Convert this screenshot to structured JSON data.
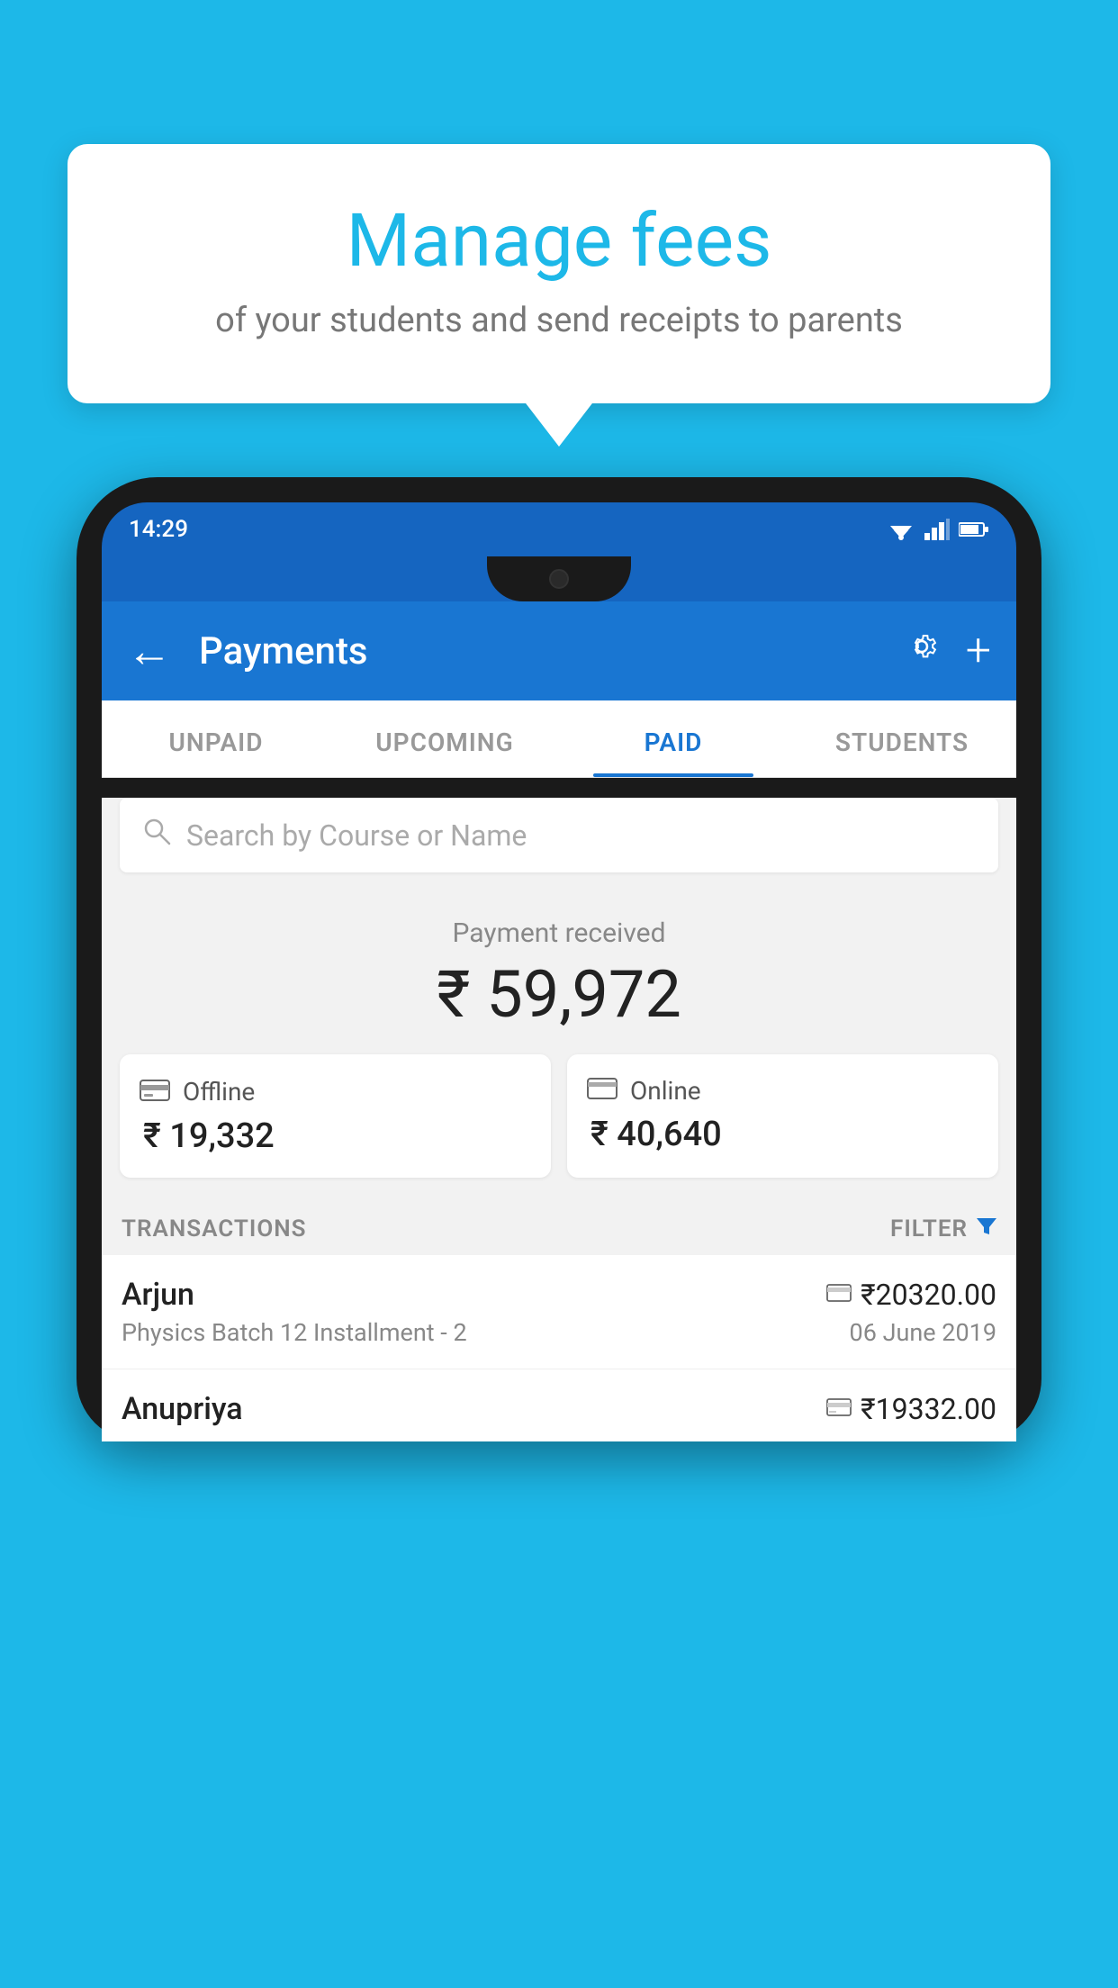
{
  "background_color": "#1db8e8",
  "speech_bubble": {
    "title": "Manage fees",
    "subtitle": "of your students and send receipts to parents"
  },
  "status_bar": {
    "time": "14:29"
  },
  "app_bar": {
    "title": "Payments",
    "back_label": "←",
    "plus_label": "+"
  },
  "tabs": [
    {
      "label": "UNPAID",
      "active": false
    },
    {
      "label": "UPCOMING",
      "active": false
    },
    {
      "label": "PAID",
      "active": true
    },
    {
      "label": "STUDENTS",
      "active": false
    }
  ],
  "search": {
    "placeholder": "Search by Course or Name"
  },
  "payment_received": {
    "label": "Payment received",
    "amount": "₹ 59,972"
  },
  "payment_cards": [
    {
      "type": "Offline",
      "amount": "₹ 19,332",
      "icon": "offline"
    },
    {
      "type": "Online",
      "amount": "₹ 40,640",
      "icon": "online"
    }
  ],
  "transactions_section": {
    "label": "TRANSACTIONS",
    "filter_label": "FILTER"
  },
  "transactions": [
    {
      "name": "Arjun",
      "course": "Physics Batch 12 Installment - 2",
      "date": "06 June 2019",
      "amount": "₹20320.00",
      "icon": "online"
    },
    {
      "name": "Anupriya",
      "course": "",
      "date": "",
      "amount": "₹19332.00",
      "icon": "offline"
    }
  ]
}
